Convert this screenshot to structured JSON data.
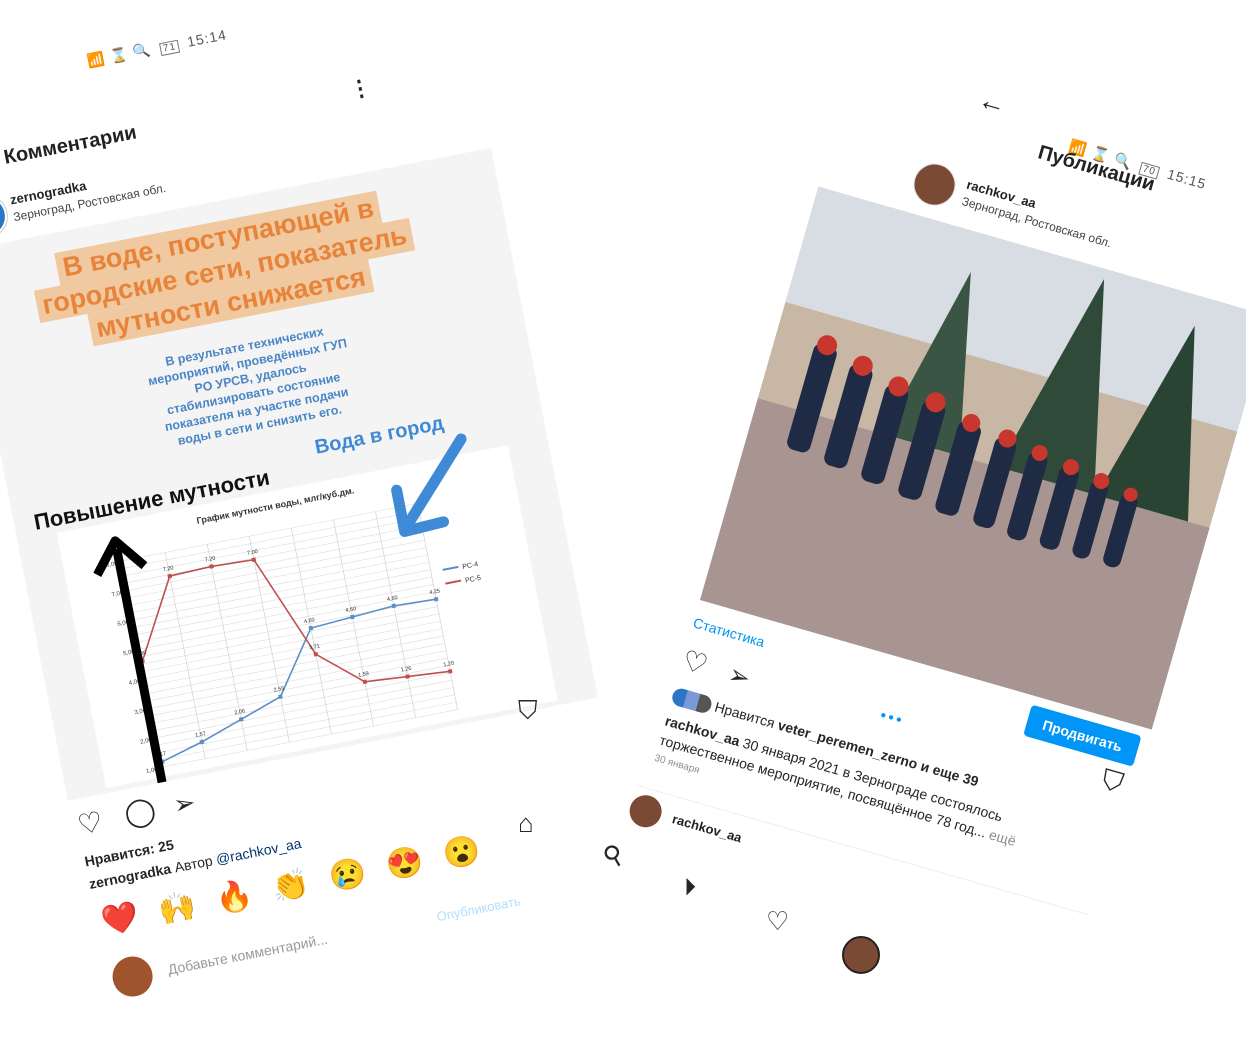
{
  "left_screen": {
    "status_bar": {
      "icons": "📶 ⌛ 🔍",
      "time": "15:14",
      "battery": "71"
    },
    "header": {
      "title": "Комментарии",
      "back_icon": "arrow-left-icon",
      "menu_icon": "more-vertical-icon"
    },
    "post": {
      "username": "zernogradka",
      "location": "Зерноград, Ростовская обл.",
      "image": {
        "headline": [
          "В воде, поступающей в",
          "городские сети, показатель",
          "мутности снижается"
        ],
        "body": [
          "В результате технических",
          "мероприятий, проведённых ГУП",
          "РО УРСВ, удалось",
          "стабилизировать состояние",
          "показателя на участке подачи",
          "воды в сети и снизить его."
        ],
        "label_increase": "Повышение мутности",
        "label_water": "Вода в город",
        "chart_title": "График мутности воды, млг/куб.дм."
      },
      "likes": "Нравится: 25",
      "caption_user": "zernogradka",
      "caption_text": "Автор",
      "caption_mention": "@rachkov_aa"
    },
    "reactions": [
      "❤️",
      "🙌",
      "🔥",
      "👏",
      "😢",
      "😍",
      "😮"
    ],
    "comment_placeholder": "Добавьте комментарий...",
    "publish_label": "Опубликовать"
  },
  "chart_data": {
    "type": "line",
    "title": "График мутности воды, млг/куб.дм.",
    "xlabel": "",
    "ylabel": "",
    "yticks": [
      "1,00",
      "2,00",
      "3,00",
      "4,00",
      "5,00",
      "6,00",
      "7,00",
      "8,00"
    ],
    "ylim": [
      1,
      8
    ],
    "x": [
      1,
      2,
      3,
      4,
      5,
      6,
      7,
      8
    ],
    "series": [
      {
        "name": "РС-4",
        "color": "#5b8fc7",
        "values": [
          1.17,
          1.57,
          2.06,
          2.55,
          4.6,
          4.7,
          4.8,
          4.75
        ]
      },
      {
        "name": "РС-5",
        "color": "#c0504d",
        "values": [
          4.6,
          7.2,
          7.25,
          7.2,
          3.71,
          2.5,
          2.4,
          2.3
        ]
      }
    ],
    "point_labels": {
      "РС-4": [
        "1,17",
        "1,57",
        "2,06",
        "2,55",
        "4,60",
        "4,60",
        "4,60",
        "4,25"
      ],
      "РС-5": [
        "4,60",
        "7,20",
        "7,20",
        "7,00",
        "3,71",
        "1,59",
        "1,26",
        "1,20"
      ]
    },
    "legend": "right",
    "grid": true
  },
  "right_screen": {
    "status_bar": {
      "icons": "📶 ⌛ 🔍",
      "time": "15:15",
      "battery": "70"
    },
    "header": {
      "title": "Публикации",
      "back_icon": "arrow-left-icon"
    },
    "post": {
      "username": "rachkov_aa",
      "location": "Зерноград, Ростовская обл.",
      "stats_label": "Статистика",
      "promote_label": "Продвигать",
      "likes_prefix": "Нравится",
      "likes_user": "veter_peremen_zerno",
      "likes_suffix": "и еще 39",
      "caption_user": "rachkov_aa",
      "caption_line1": "30 января 2021 в Зернограде состоялось",
      "caption_line2": "торжественное мероприятие, посвящённое 78 год...",
      "more_label": "ещё",
      "date": "30 января"
    },
    "next_post_user": "rachkov_aa"
  },
  "colors": {
    "accent": "#0095f6",
    "promote": "#0095f6",
    "heart": "#e0245e",
    "headline_box": "#f0c9a0",
    "headline_text": "#e8843a",
    "body_text": "#4a86c5",
    "arrow_blue": "#3f8ad6"
  }
}
